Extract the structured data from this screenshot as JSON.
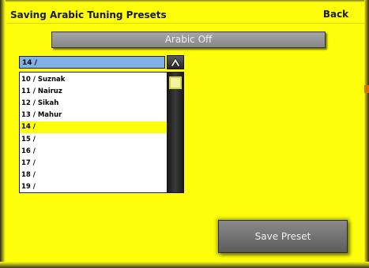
{
  "header": {
    "title": "Saving Arabic Tuning Presets",
    "back_label": "Back"
  },
  "preset_toggle": {
    "label": "Arabic Off"
  },
  "combo": {
    "current_value": "14 /"
  },
  "list": {
    "items": [
      {
        "label": "10 / Suznak"
      },
      {
        "label": "11 / Nairuz"
      },
      {
        "label": "12 / Sikah"
      },
      {
        "label": "13 / Mahur"
      },
      {
        "label": "14 /",
        "selected": true
      },
      {
        "label": "15 /"
      },
      {
        "label": "16 /"
      },
      {
        "label": "17 /"
      },
      {
        "label": "18 /"
      },
      {
        "label": "19 /"
      }
    ]
  },
  "actions": {
    "save_label": "Save Preset"
  },
  "colors": {
    "background": "#fefe0a",
    "selected_row": "#fefe0a",
    "combo_highlight": "#7fb0e6",
    "button_gray": "#8a8a8a"
  },
  "icons": {
    "combo_toggle": "chevron-up-icon",
    "scroll_thumb": "scroll-thumb"
  }
}
